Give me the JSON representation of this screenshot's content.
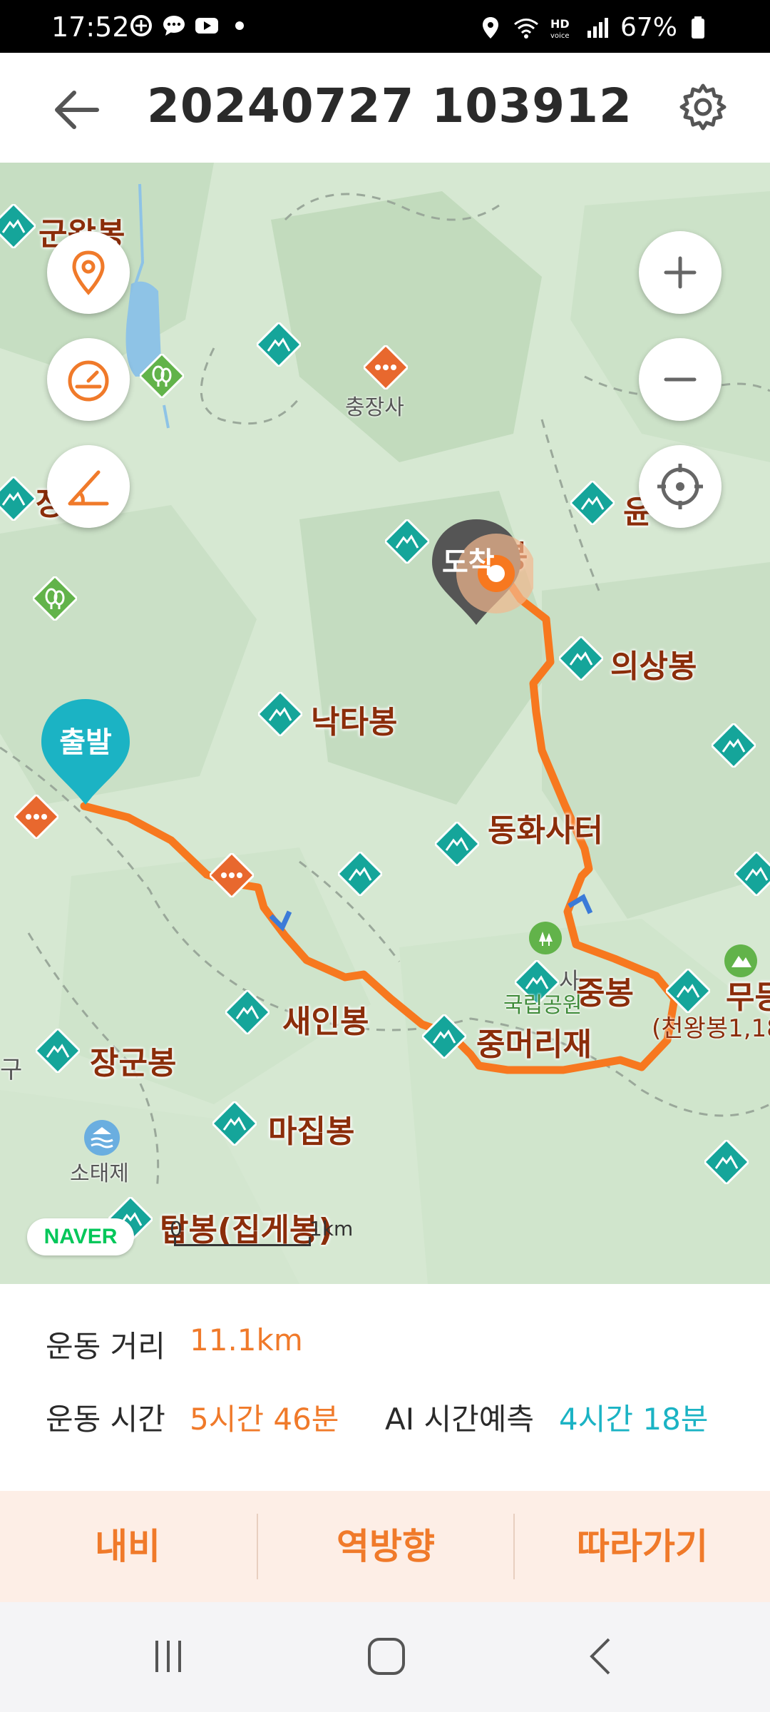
{
  "status_bar": {
    "time": "17:52",
    "battery": "67%",
    "left_icons": [
      "strava-icon",
      "chat-bubble-icon",
      "youtube-icon",
      "dot-icon"
    ],
    "right_icons": [
      "location-icon",
      "wifi-icon",
      "hd-voice-icon",
      "signal-icon",
      "battery-icon"
    ]
  },
  "header": {
    "title": "20240727 103912",
    "back_icon": "arrow-left-icon",
    "settings_icon": "gear-icon"
  },
  "map": {
    "left_controls": [
      "location-pin-icon",
      "speedometer-icon",
      "elevation-icon"
    ],
    "right_controls": [
      "zoom-in-icon",
      "zoom-out-icon",
      "my-location-icon"
    ],
    "start_marker_label": "출발",
    "end_marker_label": "도착",
    "places": {
      "gunwang": "군왕봉",
      "chungjangsa": "충장사",
      "jang": "장",
      "yun": "윤",
      "dochang_suffix": "봉",
      "uisang": "의상봉",
      "nakta": "낙타봉",
      "donghwa": "동화사터",
      "saein": "새인봉",
      "jungmeori": "중머리재",
      "jungbong": "중봉",
      "mu": "무등",
      "cheonwang": "(천왕봉1,18",
      "janggun": "장군봉",
      "sotaeje": "소태제",
      "majip": "마집봉",
      "tap": "탑봉(집게봉)",
      "gu": "구",
      "park": "국립공원",
      "park_prefix": "사"
    },
    "naver_logo": "NAVER",
    "scale": {
      "zero": "0",
      "unit": "1km"
    },
    "route_color": "#f7781f",
    "start_marker_color": "#1bb3c4",
    "end_marker_color": "#555555"
  },
  "info": {
    "distance_label": "운동 거리",
    "distance_value": "11.1km",
    "time_label": "운동 시간",
    "time_value": "5시간 46분",
    "ai_label": "AI 시간예측",
    "ai_value": "4시간 18분"
  },
  "actions": {
    "navi": "내비",
    "reverse": "역방향",
    "follow": "따라가기"
  },
  "nav_bar": [
    "recents-icon",
    "home-icon",
    "back-icon"
  ]
}
